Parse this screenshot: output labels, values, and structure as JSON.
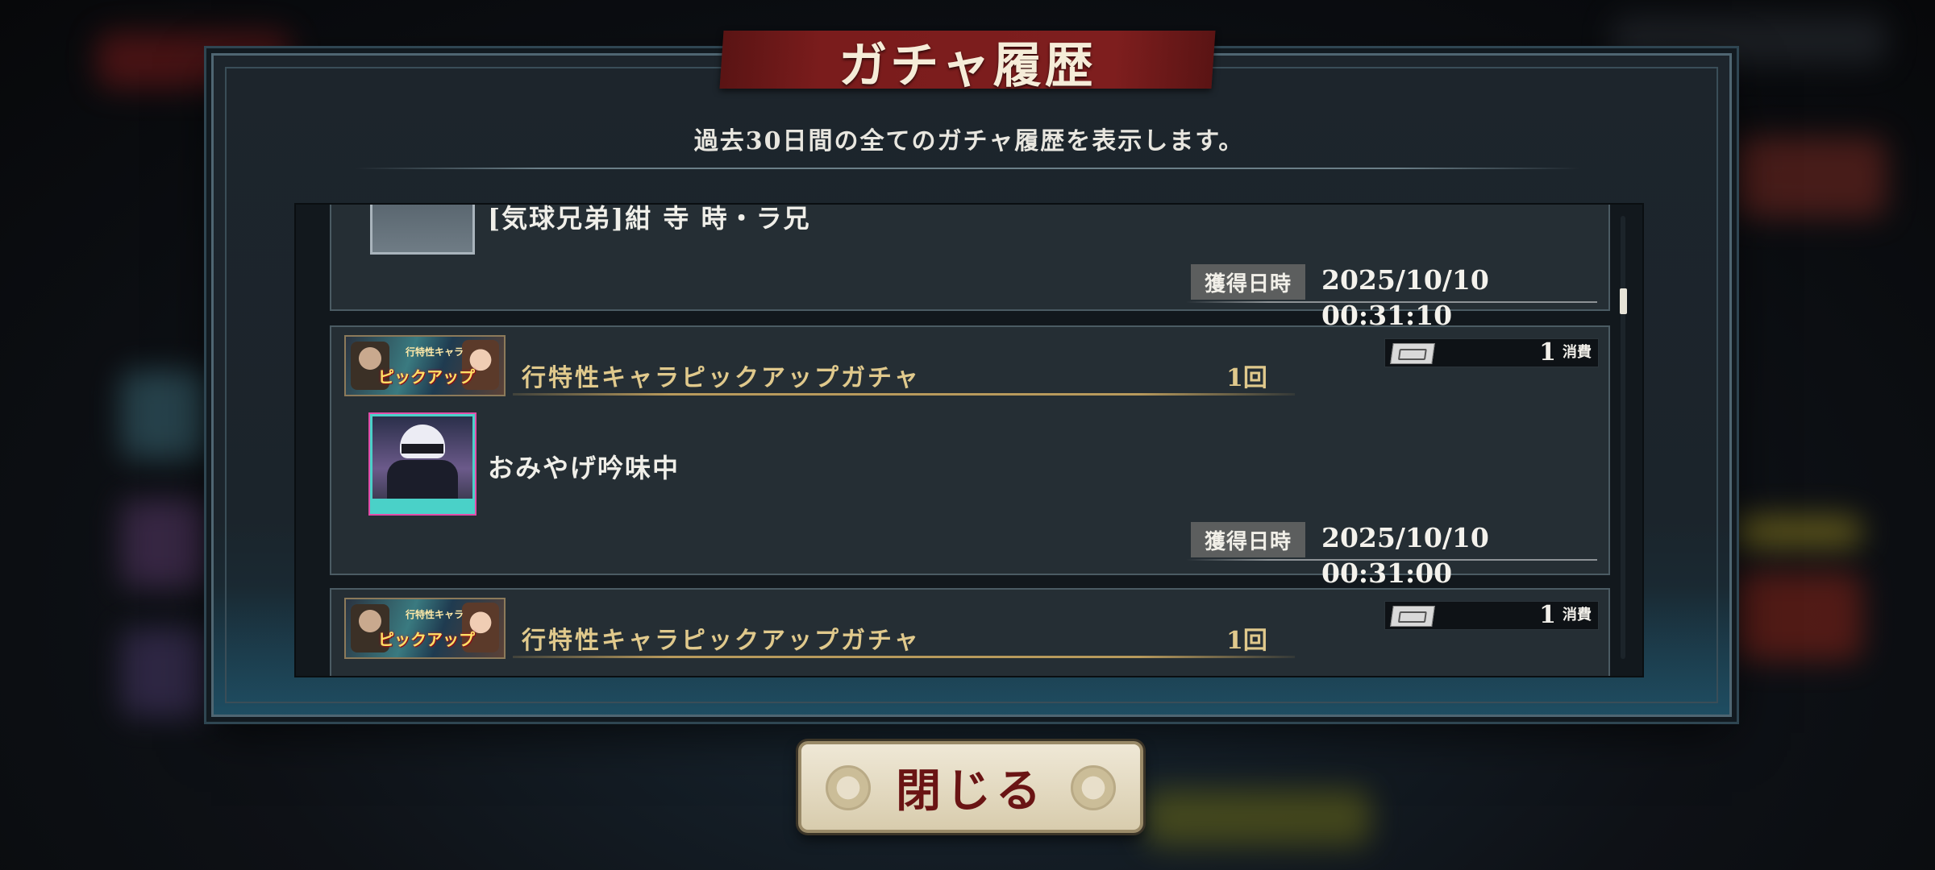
{
  "dialog": {
    "title": "ガチャ履歴",
    "subtitle": "過去30日間の全てのガチャ履歴を表示します。",
    "close_label": "閉じる"
  },
  "records": [
    {
      "item_name": "[気球兄弟]紺 寺 時・ラ兄",
      "date_label": "獲得日時",
      "date_value": "2025/10/10 00:31:10"
    },
    {
      "banner_small": "行特性キャラ",
      "banner_big": "ピックアップ",
      "gacha_name": "行特性キャラピックアップガチャ",
      "count": "1回",
      "cost_value": "1",
      "cost_label": "消費",
      "item_name": "おみやげ吟味中",
      "date_label": "獲得日時",
      "date_value": "2025/10/10 00:31:00"
    },
    {
      "banner_small": "行特性キャラ",
      "banner_big": "ピックアップ",
      "gacha_name": "行特性キャラピックアップガチャ",
      "count": "1回",
      "cost_value": "1",
      "cost_label": "消費"
    }
  ],
  "icons": {
    "ticket": "gacha-ticket-icon",
    "thumb": "character-card-thumbnail"
  },
  "colors": {
    "title_banner": "#7a1c1c",
    "gacha_name": "#e0c98c",
    "rarity_border": "#4ad1c8",
    "close_text": "#6a1414"
  }
}
